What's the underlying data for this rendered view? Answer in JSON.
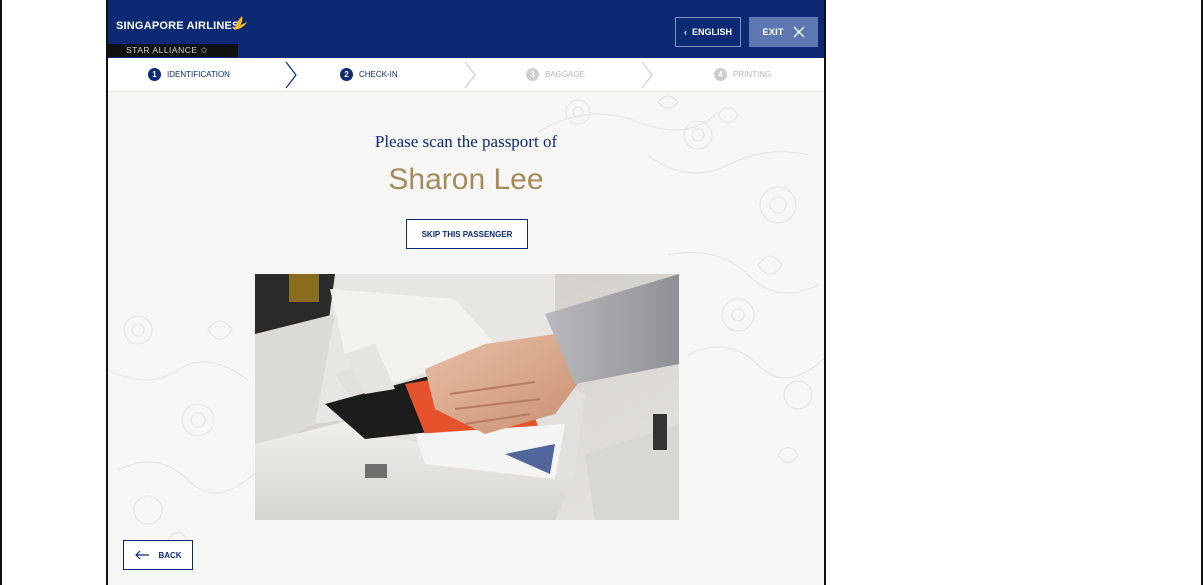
{
  "header": {
    "brand": "SINGAPORE AIRLINES",
    "alliance": "STAR ALLIANCE ✩",
    "language_label": "ENGLISH",
    "exit_label": "EXIT",
    "colors": {
      "navy": "#0c2a73",
      "gold": "#a58a5e",
      "exit_bg": "#5d77b3"
    }
  },
  "steps": [
    {
      "num": "1",
      "label": "IDENTIFICATION",
      "state": "active"
    },
    {
      "num": "2",
      "label": "CHECK-IN",
      "state": "active"
    },
    {
      "num": "3",
      "label": "BAGGAGE",
      "state": "inactive"
    },
    {
      "num": "4",
      "label": "PRINTING",
      "state": "inactive"
    }
  ],
  "main": {
    "prompt": "Please scan the passport of",
    "passenger_name": "Sharon Lee",
    "skip_label": "SKIP THIS PASSENGER"
  },
  "footer": {
    "back_label": "BACK"
  },
  "icons": [
    "singapore-airlines-bird-icon",
    "chevron-left-icon",
    "close-icon",
    "step-chevron-icon",
    "arrow-left-icon"
  ]
}
